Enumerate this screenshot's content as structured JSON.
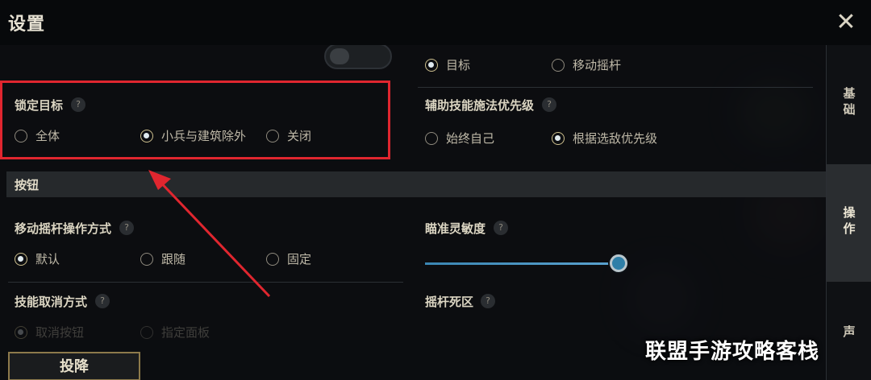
{
  "header": {
    "title": "设置",
    "close_glyph": "✕"
  },
  "top_partial": {
    "left_text": "",
    "options": [
      {
        "label": "目标",
        "checked": true
      },
      {
        "label": "移动摇杆",
        "checked": false
      }
    ]
  },
  "lock_target": {
    "label": "锁定目标",
    "help": "?",
    "options": [
      {
        "label": "全体",
        "checked": false
      },
      {
        "label": "小兵与建筑除外",
        "checked": true
      },
      {
        "label": "关闭",
        "checked": false
      }
    ]
  },
  "assist_priority": {
    "label": "辅助技能施法优先级",
    "help": "?",
    "options": [
      {
        "label": "始终自己",
        "checked": false
      },
      {
        "label": "根据选敌优先级",
        "checked": true
      }
    ]
  },
  "section": {
    "title": "按钮"
  },
  "joystick_mode": {
    "label": "移动摇杆操作方式",
    "help": "?",
    "options": [
      {
        "label": "默认",
        "checked": true
      },
      {
        "label": "跟随",
        "checked": false
      },
      {
        "label": "固定",
        "checked": false
      }
    ]
  },
  "aim_sensitivity": {
    "label": "瞄准灵敏度",
    "help": "?",
    "value_fraction": 1.0
  },
  "skill_cancel": {
    "label": "技能取消方式",
    "help": "?",
    "options": [
      {
        "label": "取消按钮",
        "checked": true
      },
      {
        "label": "指定面板",
        "checked": false
      }
    ]
  },
  "joystick_deadzone": {
    "label": "摇杆死区",
    "help": "?"
  },
  "side_tabs": [
    {
      "label": "基础",
      "active": false
    },
    {
      "label": "操作",
      "active": true
    },
    {
      "label": "声",
      "active": false
    }
  ],
  "bottom": {
    "surrender_label": "投降"
  },
  "watermark": "联盟手游攻略客栈",
  "colors": {
    "highlight": "#e0262f",
    "accent_gold": "#8d7a4b",
    "slider": "#3b86b3"
  }
}
